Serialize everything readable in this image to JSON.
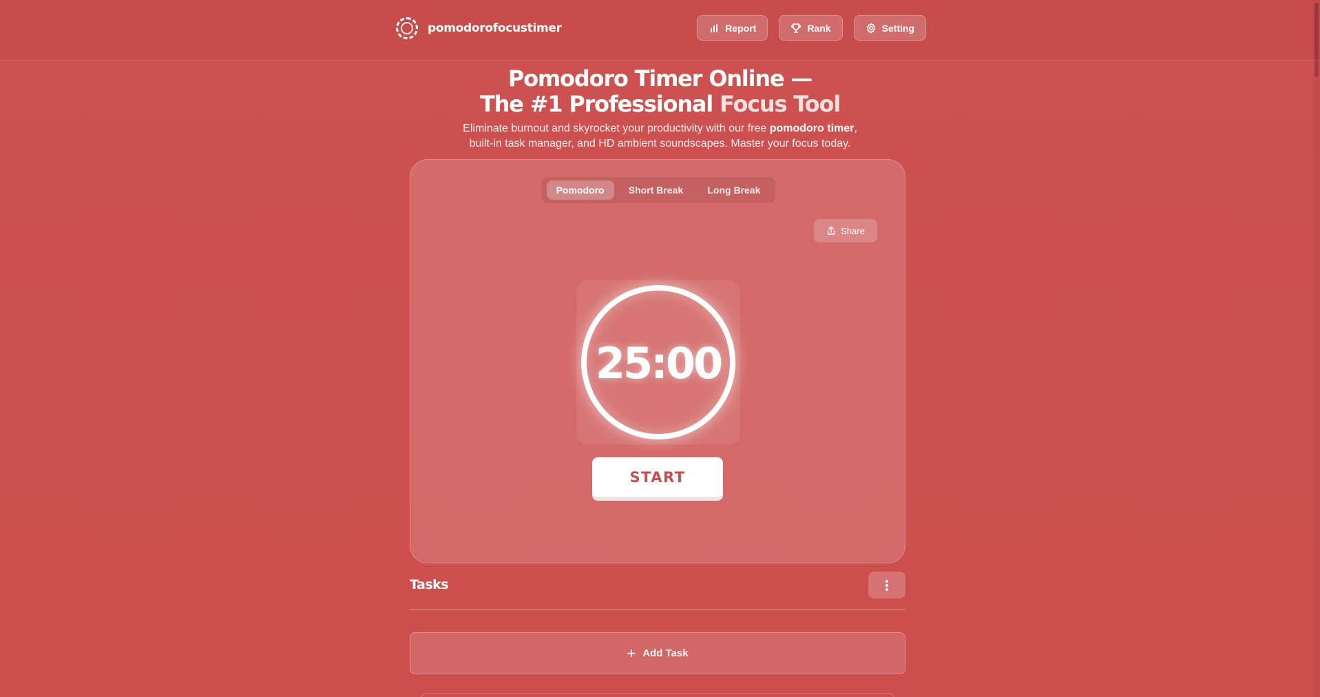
{
  "header": {
    "brand": "pomodorofocustimer",
    "nav": [
      {
        "label": "Report",
        "icon": "bar-chart-icon"
      },
      {
        "label": "Rank",
        "icon": "trophy-icon"
      },
      {
        "label": "Setting",
        "icon": "gear-icon"
      }
    ]
  },
  "hero": {
    "title_line1": "Pomodoro Timer Online —",
    "title_line2a": "The #1 Professional ",
    "title_line2b": "Focus Tool",
    "subtitle_pre": "Eliminate burnout and skyrocket your productivity with our free ",
    "subtitle_bold": "pomodoro timer",
    "subtitle_post": ",",
    "subtitle_line2": "built-in task manager, and HD ambient soundscapes. Master your focus today."
  },
  "timer": {
    "modes": [
      "Pomodoro",
      "Short Break",
      "Long Break"
    ],
    "active_mode": "Pomodoro",
    "share_label": "Share",
    "time": "25:00",
    "start_label": "START"
  },
  "tasks": {
    "title": "Tasks",
    "add_label": "Add Task"
  },
  "colors": {
    "background": "#cd5150",
    "accent_text": "#c84e4e"
  }
}
